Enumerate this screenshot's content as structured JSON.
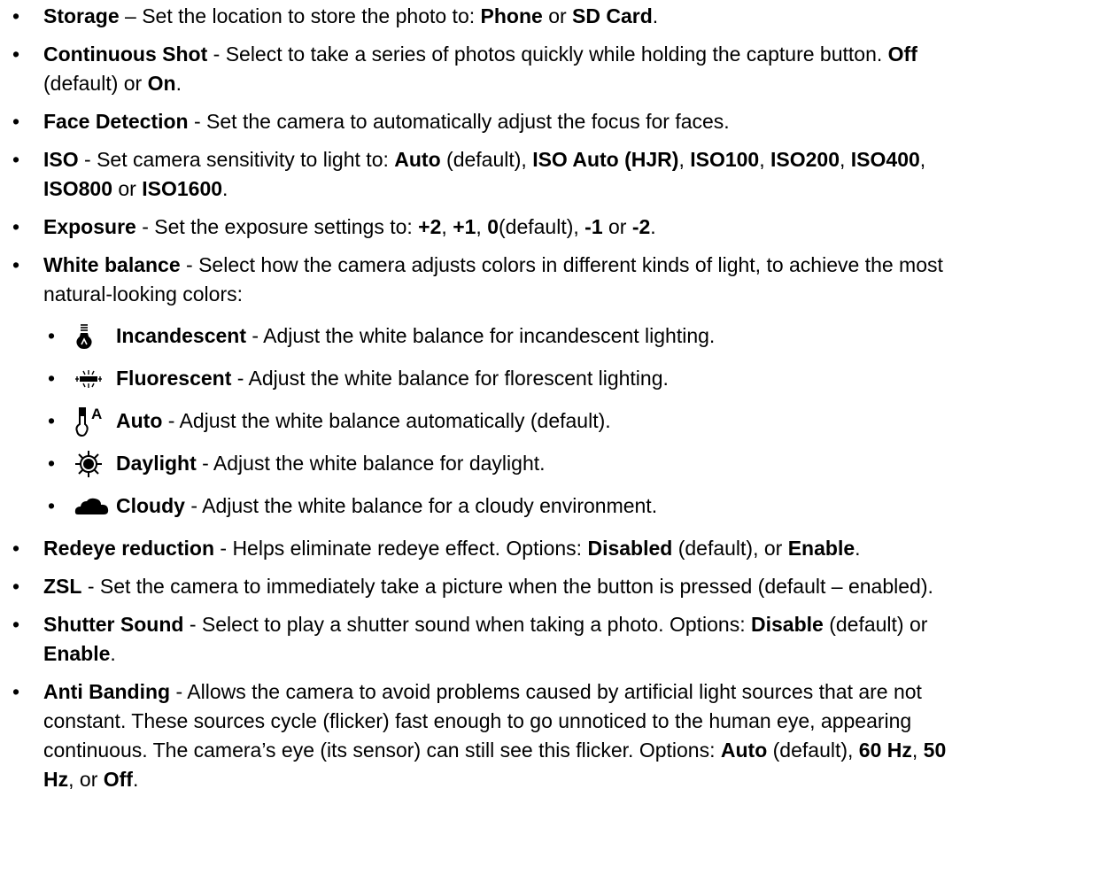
{
  "items": [
    {
      "t": [
        [
          "Storage",
          true
        ],
        [
          " – Set the location to store the photo to: ",
          false
        ],
        [
          "Phone",
          true
        ],
        [
          " or ",
          false
        ],
        [
          "SD Card",
          true
        ],
        [
          ".",
          false
        ]
      ]
    },
    {
      "t": [
        [
          "Continuous Shot",
          true
        ],
        [
          " - Select to take a series of photos quickly while holding the capture button. ",
          false
        ],
        [
          "Off",
          true
        ],
        [
          "\n(default) or ",
          false
        ],
        [
          "On",
          true
        ],
        [
          ".",
          false
        ]
      ]
    },
    {
      "t": [
        [
          "Face Detection",
          true
        ],
        [
          " - Set the camera to automatically adjust the focus for faces.",
          false
        ]
      ]
    },
    {
      "t": [
        [
          "ISO",
          true
        ],
        [
          " - Set camera sensitivity to light to: ",
          false
        ],
        [
          "Auto",
          true
        ],
        [
          " (default), ",
          false
        ],
        [
          "ISO Auto (HJR)",
          true
        ],
        [
          ", ",
          false
        ],
        [
          "ISO100",
          true
        ],
        [
          ", ",
          false
        ],
        [
          "ISO200",
          true
        ],
        [
          ", ",
          false
        ],
        [
          "ISO400",
          true
        ],
        [
          ",\n",
          false
        ],
        [
          "ISO800",
          true
        ],
        [
          " or ",
          false
        ],
        [
          "ISO1600",
          true
        ],
        [
          ".",
          false
        ]
      ]
    },
    {
      "t": [
        [
          "Exposure",
          true
        ],
        [
          " - Set the exposure settings to: ",
          false
        ],
        [
          "+2",
          true
        ],
        [
          ", ",
          false
        ],
        [
          "+1",
          true
        ],
        [
          ", ",
          false
        ],
        [
          "0",
          true
        ],
        [
          "(default), ",
          false
        ],
        [
          "-1",
          true
        ],
        [
          " or ",
          false
        ],
        [
          "-2",
          true
        ],
        [
          ".",
          false
        ]
      ]
    },
    {
      "t": [
        [
          "White balance",
          true
        ],
        [
          " - Select how the camera adjusts colors in different kinds of light, to achieve the most\nnatural-looking colors:",
          false
        ]
      ],
      "sub": [
        {
          "icon": "incandescent-bulb-icon",
          "t": [
            [
              "Incandescent",
              true
            ],
            [
              " - Adjust the white balance for incandescent lighting.",
              false
            ]
          ]
        },
        {
          "icon": "fluorescent-tube-icon",
          "t": [
            [
              "Fluorescent",
              true
            ],
            [
              " - Adjust the white balance for florescent lighting.",
              false
            ]
          ]
        },
        {
          "icon": "auto-white-balance-icon",
          "t": [
            [
              "Auto",
              true
            ],
            [
              " - Adjust the white balance automatically (default).",
              false
            ]
          ]
        },
        {
          "icon": "daylight-sun-icon",
          "t": [
            [
              "Daylight",
              true
            ],
            [
              " - Adjust the white balance for daylight.",
              false
            ]
          ]
        },
        {
          "icon": "cloudy-icon",
          "t": [
            [
              "Cloudy",
              true
            ],
            [
              " - Adjust the white balance for a cloudy environment.",
              false
            ]
          ]
        }
      ]
    },
    {
      "t": [
        [
          "Redeye reduction",
          true
        ],
        [
          " - Helps eliminate redeye effect. Options: ",
          false
        ],
        [
          "Disabled",
          true
        ],
        [
          " (default), or ",
          false
        ],
        [
          "Enable",
          true
        ],
        [
          ".",
          false
        ]
      ]
    },
    {
      "t": [
        [
          "ZSL",
          true
        ],
        [
          " - Set the camera to immediately take a picture when the button is pressed (default – enabled).",
          false
        ]
      ]
    },
    {
      "t": [
        [
          "Shutter Sound",
          true
        ],
        [
          " - Select to play a shutter sound when taking a photo. Options: ",
          false
        ],
        [
          "Disable",
          true
        ],
        [
          " (default) or\n",
          false
        ],
        [
          "Enable",
          true
        ],
        [
          ".",
          false
        ]
      ]
    },
    {
      "t": [
        [
          "Anti Banding",
          true
        ],
        [
          " - Allows the camera to avoid problems caused by artificial light sources that are not\nconstant. These sources cycle (flicker) fast enough to go unnoticed to the human eye, appearing\ncontinuous. The camera’s eye (its sensor) can still see this flicker. Options: ",
          false
        ],
        [
          "Auto",
          true
        ],
        [
          " (default), ",
          false
        ],
        [
          "60 Hz",
          true
        ],
        [
          ", ",
          false
        ],
        [
          "50\nHz",
          true
        ],
        [
          ", or ",
          false
        ],
        [
          "Off",
          true
        ],
        [
          ".",
          false
        ]
      ]
    }
  ],
  "bullet": "•"
}
